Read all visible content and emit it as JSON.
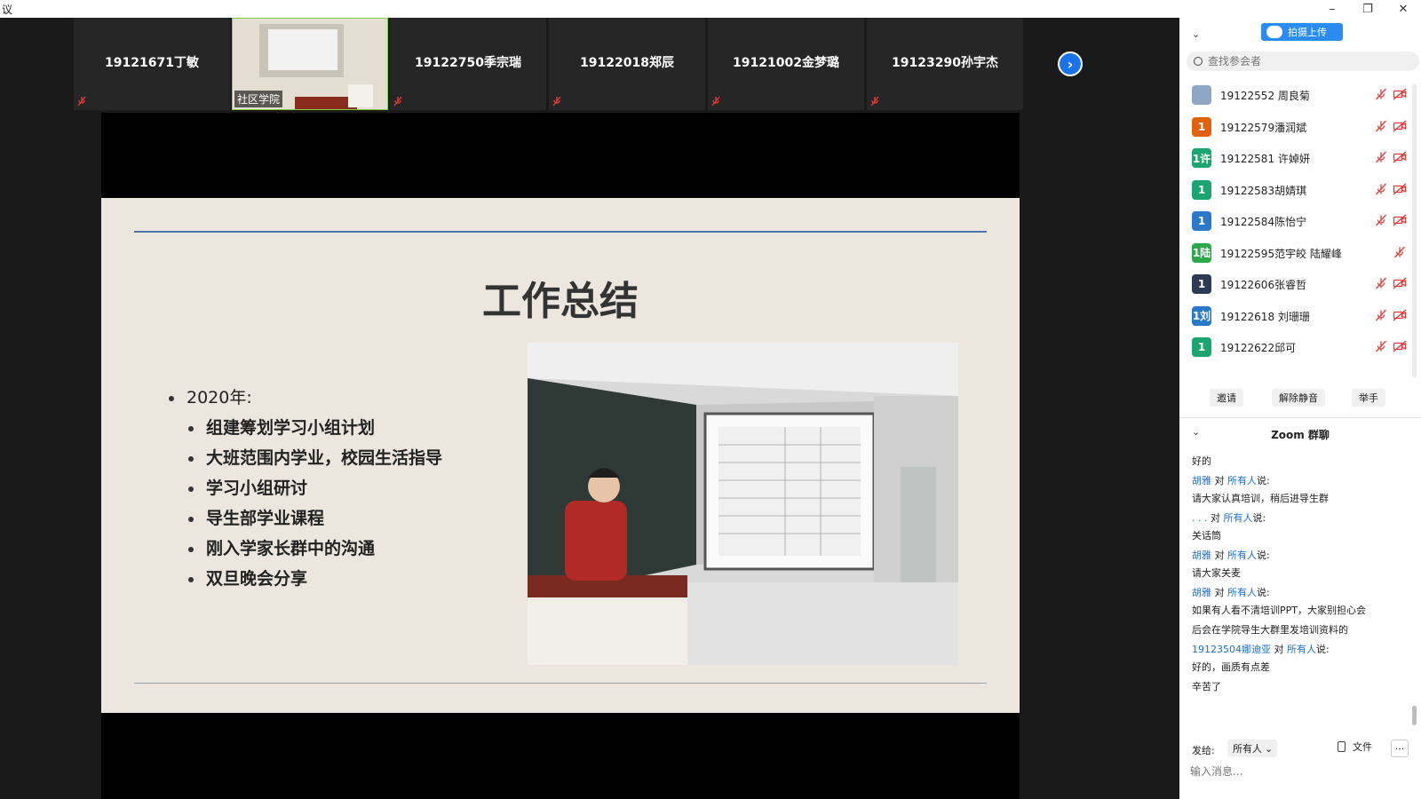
{
  "window": {
    "title": "议",
    "minimize": "–",
    "restore": "❐",
    "close": "✕"
  },
  "thumbnails": [
    {
      "name": "19121671丁敏",
      "type": "name"
    },
    {
      "name": "社区学院",
      "type": "video"
    },
    {
      "name": "19122750季宗瑞",
      "type": "name"
    },
    {
      "name": "19122018郑辰",
      "type": "name"
    },
    {
      "name": "19121002金梦璐",
      "type": "name"
    },
    {
      "name": "19123290孙宇杰",
      "type": "name"
    }
  ],
  "next_glyph": "›",
  "slide": {
    "title": "工作总结",
    "heading": "2020年:",
    "items": [
      "组建筹划学习小组计划",
      "大班范围内学业，校园生活指导",
      "学习小组研讨",
      "导生部学业课程",
      "刚入学家长群中的沟通",
      "双旦晚会分享"
    ]
  },
  "panel": {
    "upload_label": "拍摄上传",
    "search_placeholder": "查找参会者",
    "participants": [
      {
        "avatar": "",
        "name": "19122552 周良菊",
        "color": "#8fa6c4",
        "cam": true
      },
      {
        "avatar": "1",
        "name": "19122579潘润斌",
        "color": "#e0620c",
        "cam": true
      },
      {
        "avatar": "1许",
        "name": "19122581 许婥妍",
        "color": "#1aa571",
        "cam": true
      },
      {
        "avatar": "1",
        "name": "19122583胡婧琪",
        "color": "#1aa571",
        "cam": true
      },
      {
        "avatar": "1",
        "name": "19122584陈怡宁",
        "color": "#2a78c8",
        "cam": true
      },
      {
        "avatar": "1陆",
        "name": "19122595范宇皎 陆耀峰",
        "color": "#2aa84a",
        "cam": false
      },
      {
        "avatar": "1",
        "name": "19122606张睿哲",
        "color": "#2d3a55",
        "cam": true
      },
      {
        "avatar": "1刘",
        "name": "19122618 刘珊珊",
        "color": "#2a78c8",
        "cam": true
      },
      {
        "avatar": "1",
        "name": "19122622邱可",
        "color": "#1aa571",
        "cam": true
      }
    ],
    "actions": {
      "invite": "邀请",
      "unmute": "解除静音",
      "raise_hand": "举手"
    },
    "chat_title": "Zoom 群聊",
    "chat": {
      "first_text": "好的",
      "to_word": "对",
      "everyone": "所有人",
      "said": "说:",
      "messages": [
        {
          "from": "胡雅",
          "lines": [
            "请大家认真培训，稍后进导生群"
          ]
        },
        {
          "from": ". . .",
          "lines": [
            "关话筒"
          ]
        },
        {
          "from": "胡雅",
          "lines": [
            "请大家关麦"
          ]
        },
        {
          "from": "胡雅",
          "lines": [
            "如果有人看不清培训PPT，大家别担心会",
            "后会在学院导生大群里发培训资料的"
          ]
        },
        {
          "from": "19123504娜迪亚",
          "lines": [
            "好的，画质有点差",
            "辛苦了"
          ]
        }
      ]
    },
    "compose": {
      "send_to_label": "发给:",
      "recipient": "所有人",
      "file_label": "文件",
      "more": "···",
      "input_placeholder": "输入消息..."
    }
  }
}
